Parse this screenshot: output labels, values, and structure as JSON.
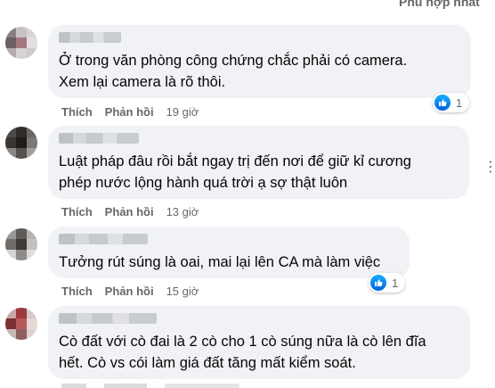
{
  "header": {
    "sort_label": "Phù hợp nhất"
  },
  "comments": [
    {
      "text": "Ở trong văn phòng công chứng chắc phải có camera.\nXem lại camera là rõ thôi.",
      "like": "Thích",
      "reply": "Phản hồi",
      "time": "19 giờ",
      "reaction_count": "1"
    },
    {
      "text": "Luật pháp đâu rồi bắt ngay trị đến nơi để giữ kỉ cương\nphép nước lộng hành quá trời ạ sợ thật luôn",
      "like": "Thích",
      "reply": "Phản hồi",
      "time": "13 giờ"
    },
    {
      "text": "Tưởng rút súng là oai, mai lại lên CA mà làm việc",
      "like": "Thích",
      "reply": "Phản hồi",
      "time": "15 giờ",
      "reaction_count": "1"
    },
    {
      "text": "Cò đất với cò đai là 2 cò cho 1 cò súng nữa là cò lên đĩa\nhết. Cò vs cói làm giá đất tăng mất kiểm soát."
    }
  ],
  "icons": {
    "like": "like-icon",
    "more": "more-options-icon"
  }
}
